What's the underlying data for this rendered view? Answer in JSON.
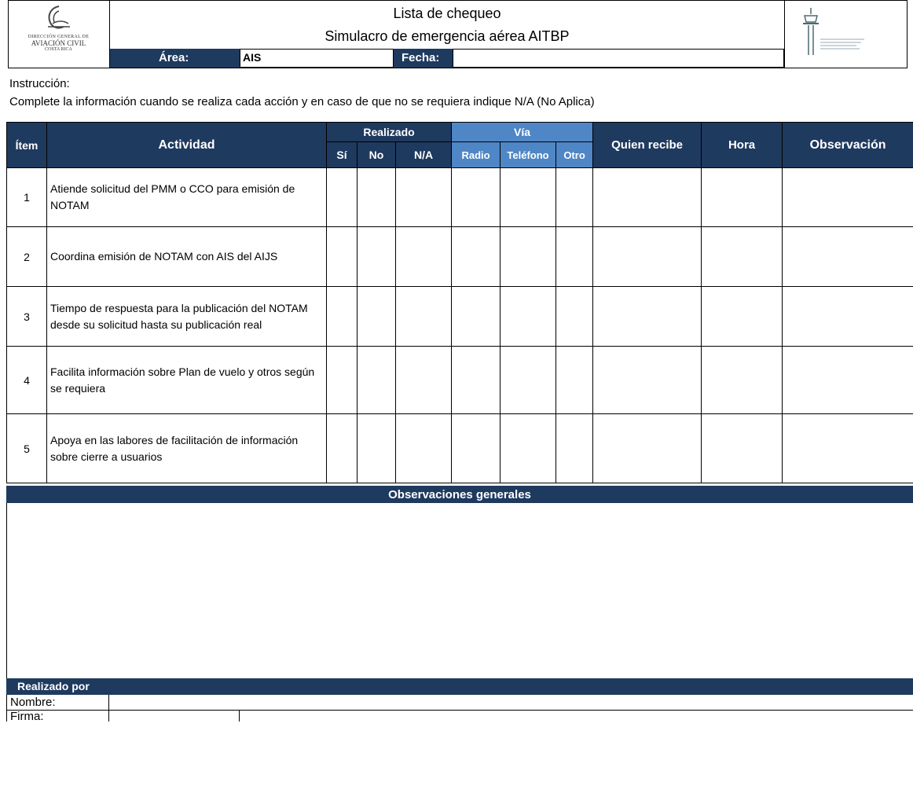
{
  "header": {
    "left_logo": {
      "line1": "DIRECCIÓN GENERAL DE",
      "line2": "AVIACIÓN CIVIL",
      "line3": "COSTA RICA"
    },
    "title": "Lista de chequeo",
    "subtitle": "Simulacro de emergencia aérea AITBP",
    "area_label": "Área:",
    "area_value": "AIS",
    "fecha_label": "Fecha:",
    "fecha_value": ""
  },
  "instruction": {
    "label": "Instrucción:",
    "text": "Complete la información cuando se realiza cada acción y en caso de que no se requiera indique N/A (No Aplica)"
  },
  "table": {
    "col_item": "Ítem",
    "col_actividad": "Actividad",
    "group_realizado": "Realizado",
    "col_si": "Sí",
    "col_no": "No",
    "col_na": "N/A",
    "group_via": "Vía",
    "col_radio": "Radio",
    "col_telefono": "Teléfono",
    "col_otro": "Otro",
    "col_quien": "Quien recibe",
    "col_hora": "Hora",
    "col_obs": "Observación",
    "rows": [
      {
        "item": "1",
        "actividad": "Atiende solicitud del PMM o CCO para emisión de NOTAM"
      },
      {
        "item": "2",
        "actividad": "Coordina emisión de NOTAM con AIS del AIJS"
      },
      {
        "item": "3",
        "actividad": "Tiempo de respuesta para la publicación del NOTAM desde su solicitud hasta su publicación real"
      },
      {
        "item": "4",
        "actividad": "Facilita información sobre Plan de vuelo y otros según se requiera"
      },
      {
        "item": "5",
        "actividad": "Apoya en las labores de facilitación de información sobre cierre a usuarios"
      }
    ]
  },
  "observaciones": {
    "label": "Observaciones generales"
  },
  "footer": {
    "realizado_por": "Realizado por",
    "nombre": "Nombre:",
    "firma": "Firma:"
  },
  "colors": {
    "navy": "#1f3a5f",
    "blue": "#4f86c6"
  }
}
